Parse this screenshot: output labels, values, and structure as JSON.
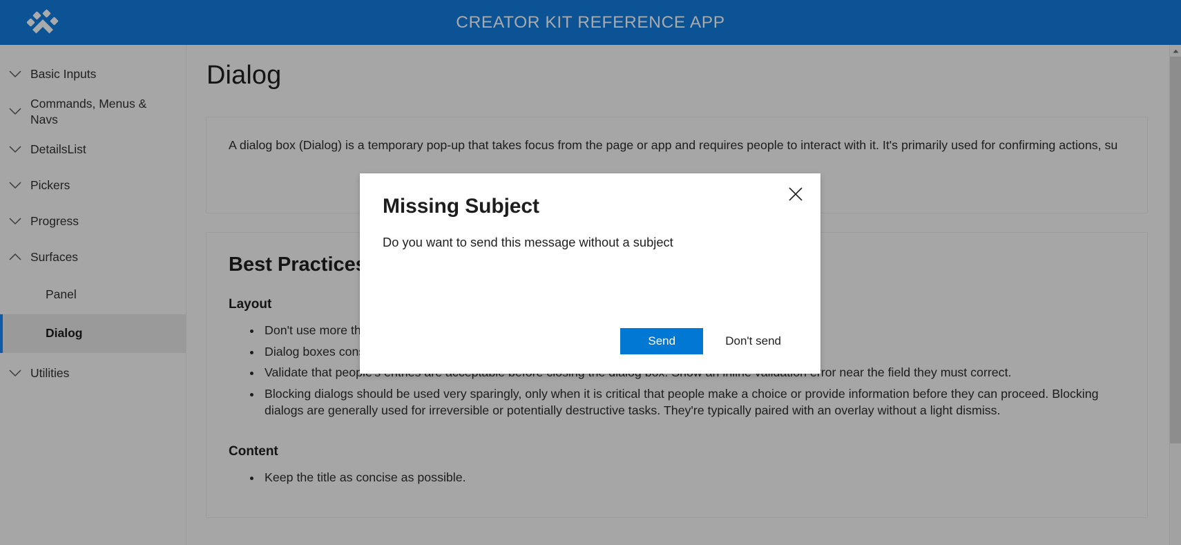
{
  "header": {
    "title": "CREATOR KIT REFERENCE APP",
    "logo_icon": "paw-logo-icon",
    "bg_color": "#0b5394",
    "title_color": "#a9aaac"
  },
  "sidebar": {
    "groups": [
      {
        "label": "Basic Inputs",
        "icon": "chevron-down-icon",
        "expanded": false
      },
      {
        "label": "Commands, Menus & Navs",
        "icon": "chevron-down-icon",
        "expanded": false
      },
      {
        "label": "DetailsList",
        "icon": "chevron-down-icon",
        "expanded": false
      },
      {
        "label": "Pickers",
        "icon": "chevron-down-icon",
        "expanded": false
      },
      {
        "label": "Progress",
        "icon": "chevron-down-icon",
        "expanded": false
      },
      {
        "label": "Surfaces",
        "icon": "chevron-up-icon",
        "expanded": true
      },
      {
        "label": "Utilities",
        "icon": "chevron-down-icon",
        "expanded": false
      }
    ],
    "surfaces_children": [
      {
        "label": "Panel",
        "selected": false
      },
      {
        "label": "Dialog",
        "selected": true
      }
    ],
    "selection_accent_color": "#0f5ba7"
  },
  "main": {
    "page_title": "Dialog",
    "description": "A dialog box (Dialog) is a temporary pop-up that takes focus from the page or app and requires people to interact with it. It's primarily used for confirming actions, su",
    "best_practices_title": "Best Practices",
    "layout_heading": "Layout",
    "layout_bullets": [
      "Don't use more than three buttons.",
      "Dialog boxes consist of a header, body, and footer.",
      "Validate that people's entries are acceptable before closing the dialog box. Show an inline validation error near the field they must correct.",
      "Blocking dialogs should be used very sparingly, only when it is critical that people make a choice or provide information before they can proceed. Blocking dialogs are generally used for irreversible or potentially destructive tasks. They're typically paired with an overlay without a light dismiss."
    ],
    "content_heading": "Content",
    "content_bullets": [
      "Keep the title as concise as possible."
    ]
  },
  "dialog": {
    "title": "Missing Subject",
    "message": "Do you want to send this message without a subject",
    "close_icon": "close-icon",
    "primary_button": "Send",
    "secondary_button": "Don't send",
    "primary_color": "#0078d4"
  },
  "scrollbar": {
    "up_arrow_icon": "scroll-up-arrow-icon"
  }
}
